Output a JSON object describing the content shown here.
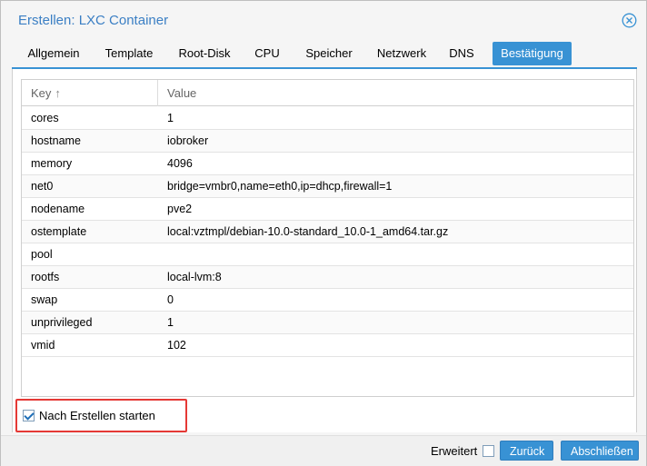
{
  "dialog": {
    "title": "Erstellen: LXC Container"
  },
  "tabs": [
    {
      "label": "Allgemein"
    },
    {
      "label": "Template"
    },
    {
      "label": "Root-Disk"
    },
    {
      "label": "CPU"
    },
    {
      "label": "Speicher"
    },
    {
      "label": "Netzwerk"
    },
    {
      "label": "DNS"
    },
    {
      "label": "Bestätigung"
    }
  ],
  "active_tab": "Bestätigung",
  "grid": {
    "columns": {
      "key": "Key",
      "value": "Value"
    },
    "rows": [
      {
        "key": "cores",
        "value": "1"
      },
      {
        "key": "hostname",
        "value": "iobroker"
      },
      {
        "key": "memory",
        "value": "4096"
      },
      {
        "key": "net0",
        "value": "bridge=vmbr0,name=eth0,ip=dhcp,firewall=1"
      },
      {
        "key": "nodename",
        "value": "pve2"
      },
      {
        "key": "ostemplate",
        "value": "local:vztmpl/debian-10.0-standard_10.0-1_amd64.tar.gz"
      },
      {
        "key": "pool",
        "value": ""
      },
      {
        "key": "rootfs",
        "value": "local-lvm:8"
      },
      {
        "key": "swap",
        "value": "0"
      },
      {
        "key": "unprivileged",
        "value": "1"
      },
      {
        "key": "vmid",
        "value": "102"
      }
    ]
  },
  "start_after_create": {
    "label": "Nach Erstellen starten",
    "checked": true
  },
  "footer": {
    "advanced_label": "Erweitert",
    "advanced_checked": false,
    "back_label": "Zurück",
    "finish_label": "Abschließen"
  },
  "colors": {
    "accent": "#3892d4",
    "title": "#3b7fc4",
    "highlight_border": "#e53935"
  }
}
